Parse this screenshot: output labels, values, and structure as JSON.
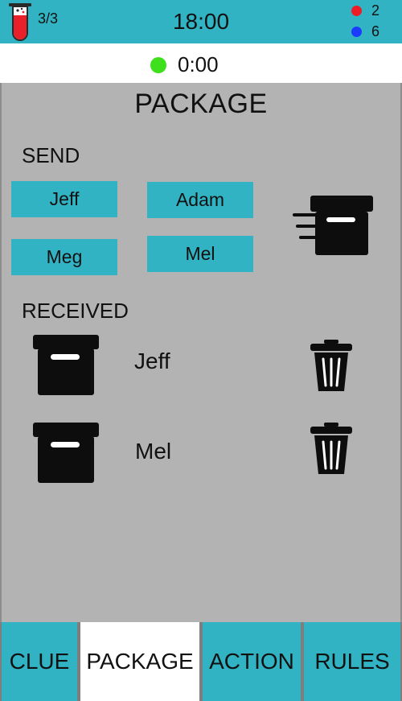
{
  "header": {
    "round_counter": "3/3",
    "clock": "18:00",
    "score_red": "2",
    "score_blue": "6",
    "icon": "test-tube-icon",
    "colors": {
      "accent": "#31b3c3",
      "red": "#ee1c24",
      "blue": "#1a3cff",
      "tube_fill": "#e8202a"
    }
  },
  "timer": {
    "value": "0:00",
    "status_color": "#3ee01e"
  },
  "page": {
    "title": "PACKAGE"
  },
  "send": {
    "label": "SEND",
    "players": [
      "Jeff",
      "Adam",
      "Meg",
      "Mel"
    ],
    "icon": "send-package-icon"
  },
  "received": {
    "label": "RECEIVED",
    "items": [
      {
        "from": "Jeff",
        "icon": "package-box-icon",
        "action_icon": "trash-icon"
      },
      {
        "from": "Mel",
        "icon": "package-box-icon",
        "action_icon": "trash-icon"
      }
    ]
  },
  "tabs": [
    {
      "label": "CLUE",
      "active": false
    },
    {
      "label": "PACKAGE",
      "active": true
    },
    {
      "label": "ACTION",
      "active": false
    },
    {
      "label": "RULES",
      "active": false
    }
  ]
}
